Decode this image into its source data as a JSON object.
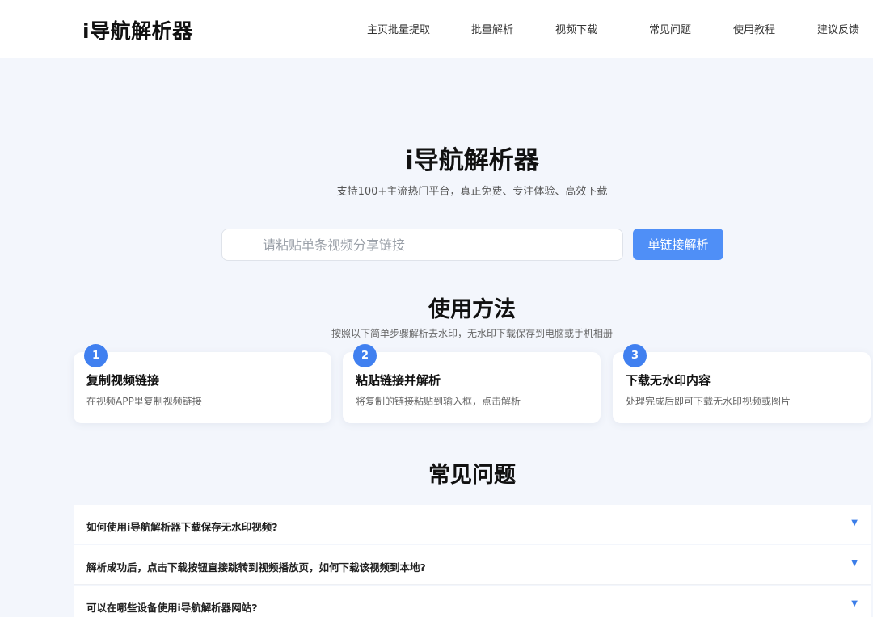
{
  "header": {
    "logo": "i导航解析器",
    "nav": [
      {
        "label": "主页批量提取"
      },
      {
        "label": "批量解析"
      },
      {
        "label": "视频下载"
      },
      {
        "label": "常见问题"
      },
      {
        "label": "使用教程"
      },
      {
        "label": "建议反馈"
      }
    ]
  },
  "hero": {
    "title": "i导航解析器",
    "subtitle": "支持100+主流热门平台，真正免费、专注体验、高效下载",
    "search": {
      "placeholder": "请粘贴单条视频分享链接",
      "value": ""
    },
    "button_label": "单链接解析"
  },
  "usage": {
    "title": "使用方法",
    "subtitle": "按照以下简单步骤解析去水印，无水印下载保存到电脑或手机相册",
    "steps": [
      {
        "num": "1",
        "title": "复制视频链接",
        "desc": "在视频APP里复制视频链接"
      },
      {
        "num": "2",
        "title": "粘贴链接并解析",
        "desc": "将复制的链接粘贴到输入框，点击解析"
      },
      {
        "num": "3",
        "title": "下载无水印内容",
        "desc": "处理完成后即可下载无水印视频或图片"
      }
    ]
  },
  "faq": {
    "title": "常见问题",
    "arrow": "▼",
    "items": [
      {
        "question": "如何使用i导航解析器下载保存无水印视频?"
      },
      {
        "question": "解析成功后，点击下载按钮直接跳转到视频播放页，如何下载该视频到本地?"
      },
      {
        "question": "可以在哪些设备使用i导航解析器网站?"
      }
    ]
  },
  "colors": {
    "accent": "#4f8ff7",
    "step_badge": "#4080f0",
    "page_bg": "#f3f6fc"
  }
}
